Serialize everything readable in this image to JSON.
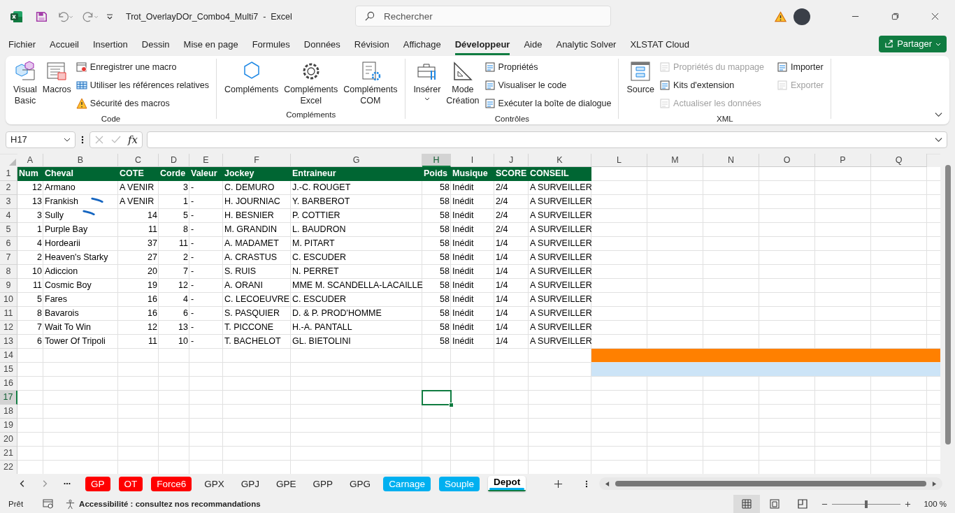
{
  "title_bar": {
    "title": "Trot_OverlayDOr_Combo4_Multi7  -  Excel",
    "search": {
      "placeholder": "Rechercher"
    }
  },
  "menu_tabs": [
    {
      "label": "Fichier",
      "selected": false
    },
    {
      "label": "Accueil",
      "selected": false
    },
    {
      "label": "Insertion",
      "selected": false
    },
    {
      "label": "Dessin",
      "selected": false
    },
    {
      "label": "Mise en page",
      "selected": false
    },
    {
      "label": "Formules",
      "selected": false
    },
    {
      "label": "Données",
      "selected": false
    },
    {
      "label": "Révision",
      "selected": false
    },
    {
      "label": "Affichage",
      "selected": false
    },
    {
      "label": "Développeur",
      "selected": true
    },
    {
      "label": "Aide",
      "selected": false
    },
    {
      "label": "Analytic Solver",
      "selected": false
    },
    {
      "label": "XLSTAT Cloud",
      "selected": false
    }
  ],
  "share_button": {
    "label": "Partager"
  },
  "ribbon": {
    "groups": [
      {
        "label": "Code",
        "large": [
          {
            "label": "Visual\nBasic"
          },
          {
            "label": "Macros"
          }
        ],
        "small": [
          {
            "label": "Enregistrer une macro",
            "disabled": false
          },
          {
            "label": "Utiliser les références relatives",
            "disabled": false
          },
          {
            "label": "Sécurité des macros",
            "disabled": false
          }
        ]
      },
      {
        "label": "Compléments",
        "large": [
          {
            "label": "Compléments"
          },
          {
            "label": "Compléments\nExcel"
          },
          {
            "label": "Compléments\nCOM"
          }
        ]
      },
      {
        "label": "Contrôles",
        "large": [
          {
            "label": "Insérer",
            "dropdown": true
          },
          {
            "label": "Mode\nCréation"
          }
        ],
        "small": [
          {
            "label": "Propriétés",
            "disabled": false
          },
          {
            "label": "Visualiser le code",
            "disabled": false
          },
          {
            "label": "Exécuter la boîte de dialogue",
            "disabled": false
          }
        ]
      },
      {
        "label": "XML",
        "large": [
          {
            "label": "Source"
          }
        ],
        "small": [
          {
            "label": "Propriétés du mappage",
            "disabled": true
          },
          {
            "label": "Kits d'extension",
            "disabled": false
          },
          {
            "label": "Actualiser les données",
            "disabled": true
          },
          {
            "label": "Importer",
            "disabled": false
          },
          {
            "label": "Exporter",
            "disabled": true
          }
        ]
      }
    ]
  },
  "formula_bar": {
    "name_box": "H17",
    "function_label": "fx"
  },
  "sheet": {
    "columns": [
      {
        "label": "A",
        "selected": false
      },
      {
        "label": "B",
        "selected": false
      },
      {
        "label": "C",
        "selected": false
      },
      {
        "label": "D",
        "selected": false
      },
      {
        "label": "E",
        "selected": false
      },
      {
        "label": "F",
        "selected": false
      },
      {
        "label": "G",
        "selected": false
      },
      {
        "label": "H",
        "selected": true
      },
      {
        "label": "I",
        "selected": false
      },
      {
        "label": "J",
        "selected": false
      },
      {
        "label": "K",
        "selected": false
      },
      {
        "label": "L",
        "selected": false
      },
      {
        "label": "M",
        "selected": false
      },
      {
        "label": "N",
        "selected": false
      },
      {
        "label": "O",
        "selected": false
      },
      {
        "label": "P",
        "selected": false
      },
      {
        "label": "Q",
        "selected": false
      }
    ],
    "rows": [
      {
        "number": "1",
        "selected": false,
        "kind": "header",
        "cells": [
          "Num",
          "Cheval",
          "COTE",
          "Corde",
          "Valeur",
          "Jockey",
          "Entraineur",
          "Poids",
          "Musique",
          "SCORE",
          "CONSEIL"
        ]
      },
      {
        "number": "2",
        "selected": false,
        "kind": "data",
        "cells": [
          "12",
          "Armano",
          "A VENIR",
          "3",
          "-",
          "C. DEMURO",
          "J.-C. ROUGET",
          "58",
          "Inédit",
          "2/4",
          "A SURVEILLER"
        ]
      },
      {
        "number": "3",
        "selected": false,
        "kind": "data",
        "ink_stroke": true,
        "cells": [
          "13",
          "Frankish",
          "A VENIR",
          "1",
          "-",
          "H. JOURNIAC",
          "Y. BARBEROT",
          "58",
          "Inédit",
          "2/4",
          "A SURVEILLER"
        ]
      },
      {
        "number": "4",
        "selected": false,
        "kind": "data",
        "ink_stroke": true,
        "cells": [
          "3",
          "Sully",
          "14",
          "5",
          "-",
          "H. BESNIER",
          "P. COTTIER",
          "58",
          "Inédit",
          "2/4",
          "A SURVEILLER"
        ]
      },
      {
        "number": "5",
        "selected": false,
        "kind": "data",
        "cells": [
          "1",
          "Purple Bay",
          "11",
          "8",
          "-",
          "M. GRANDIN",
          "L. BAUDRON",
          "58",
          "Inédit",
          "2/4",
          "A SURVEILLER"
        ]
      },
      {
        "number": "6",
        "selected": false,
        "kind": "data",
        "cells": [
          "4",
          "Hordearii",
          "37",
          "11",
          "-",
          "A. MADAMET",
          "M. PITART",
          "58",
          "Inédit",
          "1/4",
          "A SURVEILLER"
        ]
      },
      {
        "number": "7",
        "selected": false,
        "kind": "data",
        "cells": [
          "2",
          "Heaven's Starky",
          "27",
          "2",
          "-",
          "A. CRASTUS",
          "C. ESCUDER",
          "58",
          "Inédit",
          "1/4",
          "A SURVEILLER"
        ]
      },
      {
        "number": "8",
        "selected": false,
        "kind": "data",
        "cells": [
          "10",
          "Adiccion",
          "20",
          "7",
          "-",
          "S. RUIS",
          "N. PERRET",
          "58",
          "Inédit",
          "1/4",
          "A SURVEILLER"
        ]
      },
      {
        "number": "9",
        "selected": false,
        "kind": "data",
        "cells": [
          "11",
          "Cosmic Boy",
          "19",
          "12",
          "-",
          "A. ORANI",
          "MME M. SCANDELLA-LACAILLE",
          "58",
          "Inédit",
          "1/4",
          "A SURVEILLER"
        ]
      },
      {
        "number": "10",
        "selected": false,
        "kind": "data",
        "cells": [
          "5",
          "Fares",
          "16",
          "4",
          "-",
          "C. LECOEUVRE",
          "C. ESCUDER",
          "58",
          "Inédit",
          "1/4",
          "A SURVEILLER"
        ]
      },
      {
        "number": "11",
        "selected": false,
        "kind": "data",
        "cells": [
          "8",
          "Bavarois",
          "16",
          "6",
          "-",
          "S. PASQUIER",
          "D. & P. PROD'HOMME",
          "58",
          "Inédit",
          "1/4",
          "A SURVEILLER"
        ]
      },
      {
        "number": "12",
        "selected": false,
        "kind": "data",
        "cells": [
          "7",
          "Wait To Win",
          "12",
          "13",
          "-",
          "T. PICCONE",
          "H.-A. PANTALL",
          "58",
          "Inédit",
          "1/4",
          "A SURVEILLER"
        ]
      },
      {
        "number": "13",
        "selected": false,
        "kind": "data",
        "cells": [
          "6",
          "Tower Of Tripoli",
          "11",
          "10",
          "-",
          "T. BACHELOT",
          "GL. BIETOLINI",
          "58",
          "Inédit",
          "1/4",
          "A SURVEILLER"
        ]
      },
      {
        "number": "14",
        "selected": false,
        "kind": "empty",
        "color": "#ff8000"
      },
      {
        "number": "15",
        "selected": false,
        "kind": "empty",
        "color": "#cce4f7"
      },
      {
        "number": "16",
        "selected": false,
        "kind": "empty"
      },
      {
        "number": "17",
        "selected": true,
        "kind": "empty"
      },
      {
        "number": "18",
        "selected": false,
        "kind": "empty"
      },
      {
        "number": "19",
        "selected": false,
        "kind": "empty"
      },
      {
        "number": "20",
        "selected": false,
        "kind": "empty"
      },
      {
        "number": "21",
        "selected": false,
        "kind": "empty"
      },
      {
        "number": "22",
        "selected": false,
        "kind": "empty"
      }
    ]
  },
  "sheet_tabs": [
    {
      "label": "GP",
      "color": "#ff0000",
      "selected": false
    },
    {
      "label": "OT",
      "color": "#ff0000",
      "selected": false
    },
    {
      "label": "Force6",
      "color": "#ff0000",
      "selected": false
    },
    {
      "label": "GPX",
      "selected": false
    },
    {
      "label": "GPJ",
      "selected": false
    },
    {
      "label": "GPE",
      "selected": false
    },
    {
      "label": "GPP",
      "selected": false
    },
    {
      "label": "GPG",
      "selected": false
    },
    {
      "label": "Carnage",
      "color": "#00b0f0",
      "selected": false
    },
    {
      "label": "Souple",
      "color": "#00b0f0",
      "selected": false
    },
    {
      "label": "Depot",
      "color": "#00b0f0",
      "selected": true
    }
  ],
  "status_bar": {
    "status": "Prêt",
    "accessibility": "Accessibilité : consultez nos recommandations",
    "zoom": {
      "level": 0.5,
      "reading": "100 %"
    }
  }
}
